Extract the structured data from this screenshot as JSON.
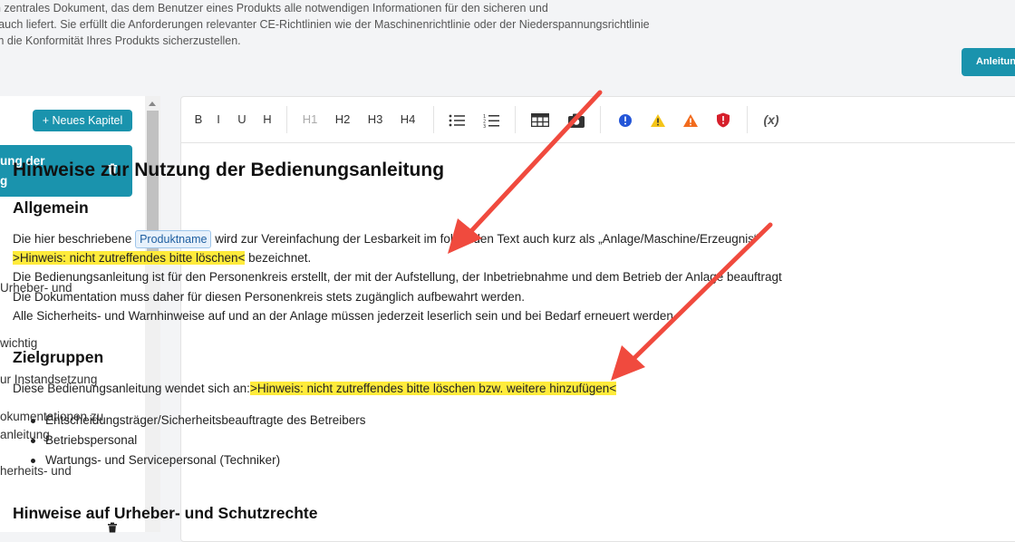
{
  "intro": {
    "lines": [
      "n zentrales Dokument, das dem Benutzer eines Produkts alle notwendigen Informationen für den sicheren und",
      "rauch liefert. Sie erfüllt die Anforderungen relevanter CE-Richtlinien wie der Maschinenrichtlinie oder der Niederspannungsrichtlinie",
      "m die Konformität Ihres Produkts sicherzustellen."
    ]
  },
  "top_button": "Anleitung",
  "sidebar": {
    "new_chapter": "+ Neues Kapitel",
    "active": {
      "line1": "ung der",
      "line2": "g"
    },
    "items": [
      "Urheber- und",
      "wichtig",
      "ur Instandsetzung",
      "okumentationen zu",
      "anleitung",
      "herheits- und"
    ]
  },
  "toolbar": {
    "bold": "B",
    "italic": "I",
    "underline": "U",
    "heading": "H",
    "h1": "H1",
    "h2": "H2",
    "h3": "H3",
    "h4": "H4",
    "variable": "(x)"
  },
  "doc": {
    "title": "Hinweise zur Nutzung der Bedienungsanleitung",
    "s1_heading": "Allgemein",
    "s1_p1_pre": "Die hier beschriebene ",
    "s1_p1_chip": "Produktname",
    "s1_p1_post": " wird zur Vereinfachung der Lesbarkeit im folgenden Text auch kurz als „Anlage/Maschine/Erzeugnis“",
    "s1_p2_hl": ">Hinweis: nicht zutreffendes bitte löschen<",
    "s1_p2_post": " bezeichnet.",
    "s1_p3": "Die Bedienungsanleitung ist für den Personenkreis erstellt, der mit der Aufstellung, der Inbetriebnahme und dem Betrieb der Anlage beauftragt",
    "s1_p4": "Die Dokumentation muss daher für diesen Personenkreis stets zugänglich aufbewahrt werden.",
    "s1_p5": "Alle Sicherheits- und Warnhinweise auf und an der Anlage müssen jederzeit leserlich sein und bei Bedarf erneuert werden.",
    "s2_heading": "Zielgruppen",
    "s2_p1_pre": "Diese Bedienungsanleitung wendet sich an:",
    "s2_p1_hl": ">Hinweis: nicht zutreffendes bitte löschen bzw. weitere hinzufügen<",
    "s2_list": [
      "Entscheidungsträger/Sicherheitsbeauftragte des Betreibers",
      "Betriebspersonal",
      "Wartungs- und Servicepersonal (Techniker)"
    ],
    "s3_heading": "Hinweise auf Urheber- und Schutzrechte"
  },
  "colors": {
    "accent": "#1a93ad",
    "highlight": "#ffeb3b",
    "arrow": "#f04a3e"
  }
}
